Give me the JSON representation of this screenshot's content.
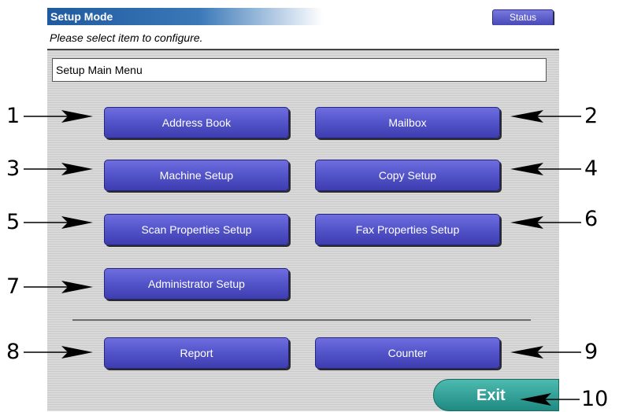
{
  "header": {
    "title": "Setup Mode",
    "status_label": "Status"
  },
  "subtitle": "Please select item to configure.",
  "menu_title": "Setup Main Menu",
  "buttons": {
    "address_book": "Address Book",
    "mailbox": "Mailbox",
    "machine_setup": "Machine Setup",
    "copy_setup": "Copy Setup",
    "scan_properties": "Scan Properties Setup",
    "fax_properties": "Fax Properties Setup",
    "administrator": "Administrator Setup",
    "report": "Report",
    "counter": "Counter",
    "exit": "Exit"
  },
  "callouts": [
    "1",
    "2",
    "3",
    "4",
    "5",
    "6",
    "7",
    "8",
    "9",
    "10"
  ],
  "colors": {
    "button": "#5656cc",
    "title_bar": "#1f5a9e",
    "exit": "#2aa39a"
  }
}
